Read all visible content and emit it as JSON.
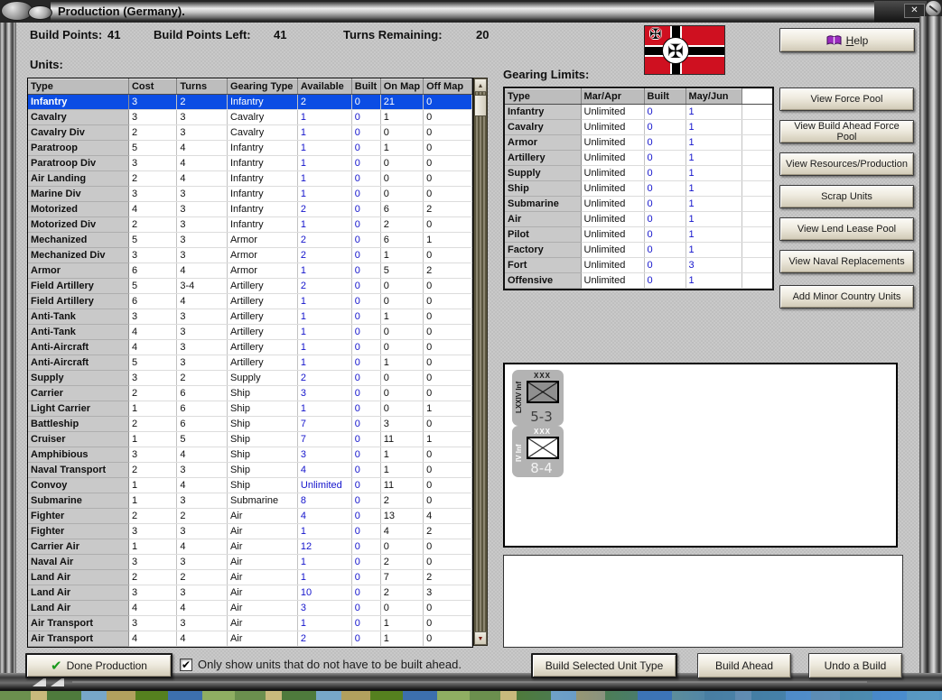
{
  "window": {
    "title": "Production (Germany).",
    "close_glyph": "✕"
  },
  "header": {
    "build_points_label": "Build Points:",
    "build_points_value": "41",
    "build_points_left_label": "Build Points Left:",
    "build_points_left_value": "41",
    "turns_remaining_label": "Turns Remaining:",
    "turns_remaining_value": "20",
    "help_label": "Help"
  },
  "units_section": {
    "label": "Units:",
    "columns": [
      "Type",
      "Cost",
      "Turns",
      "Gearing Type",
      "Available",
      "Built",
      "On Map",
      "Off Map"
    ],
    "rows": [
      {
        "type": "Infantry",
        "cost": "3",
        "turns": "2",
        "gearing": "Infantry",
        "available": "2",
        "built": "0",
        "on_map": "21",
        "off_map": "0",
        "selected": true
      },
      {
        "type": "Cavalry",
        "cost": "3",
        "turns": "3",
        "gearing": "Cavalry",
        "available": "1",
        "built": "0",
        "on_map": "1",
        "off_map": "0"
      },
      {
        "type": "Cavalry Div",
        "cost": "2",
        "turns": "3",
        "gearing": "Cavalry",
        "available": "1",
        "built": "0",
        "on_map": "0",
        "off_map": "0"
      },
      {
        "type": "Paratroop",
        "cost": "5",
        "turns": "4",
        "gearing": "Infantry",
        "available": "1",
        "built": "0",
        "on_map": "1",
        "off_map": "0"
      },
      {
        "type": "Paratroop Div",
        "cost": "3",
        "turns": "4",
        "gearing": "Infantry",
        "available": "1",
        "built": "0",
        "on_map": "0",
        "off_map": "0"
      },
      {
        "type": "Air Landing",
        "cost": "2",
        "turns": "4",
        "gearing": "Infantry",
        "available": "1",
        "built": "0",
        "on_map": "0",
        "off_map": "0"
      },
      {
        "type": "Marine Div",
        "cost": "3",
        "turns": "3",
        "gearing": "Infantry",
        "available": "1",
        "built": "0",
        "on_map": "0",
        "off_map": "0"
      },
      {
        "type": "Motorized",
        "cost": "4",
        "turns": "3",
        "gearing": "Infantry",
        "available": "2",
        "built": "0",
        "on_map": "6",
        "off_map": "2"
      },
      {
        "type": "Motorized Div",
        "cost": "2",
        "turns": "3",
        "gearing": "Infantry",
        "available": "1",
        "built": "0",
        "on_map": "2",
        "off_map": "0"
      },
      {
        "type": "Mechanized",
        "cost": "5",
        "turns": "3",
        "gearing": "Armor",
        "available": "2",
        "built": "0",
        "on_map": "6",
        "off_map": "1"
      },
      {
        "type": "Mechanized Div",
        "cost": "3",
        "turns": "3",
        "gearing": "Armor",
        "available": "2",
        "built": "0",
        "on_map": "1",
        "off_map": "0"
      },
      {
        "type": "Armor",
        "cost": "6",
        "turns": "4",
        "gearing": "Armor",
        "available": "1",
        "built": "0",
        "on_map": "5",
        "off_map": "2"
      },
      {
        "type": "Field Artillery",
        "cost": "5",
        "turns": "3-4",
        "gearing": "Artillery",
        "available": "2",
        "built": "0",
        "on_map": "0",
        "off_map": "0"
      },
      {
        "type": "Field Artillery",
        "cost": "6",
        "turns": "4",
        "gearing": "Artillery",
        "available": "1",
        "built": "0",
        "on_map": "0",
        "off_map": "0"
      },
      {
        "type": "Anti-Tank",
        "cost": "3",
        "turns": "3",
        "gearing": "Artillery",
        "available": "1",
        "built": "0",
        "on_map": "1",
        "off_map": "0"
      },
      {
        "type": "Anti-Tank",
        "cost": "4",
        "turns": "3",
        "gearing": "Artillery",
        "available": "1",
        "built": "0",
        "on_map": "0",
        "off_map": "0"
      },
      {
        "type": "Anti-Aircraft",
        "cost": "4",
        "turns": "3",
        "gearing": "Artillery",
        "available": "1",
        "built": "0",
        "on_map": "0",
        "off_map": "0"
      },
      {
        "type": "Anti-Aircraft",
        "cost": "5",
        "turns": "3",
        "gearing": "Artillery",
        "available": "1",
        "built": "0",
        "on_map": "1",
        "off_map": "0"
      },
      {
        "type": "Supply",
        "cost": "3",
        "turns": "2",
        "gearing": "Supply",
        "available": "2",
        "built": "0",
        "on_map": "0",
        "off_map": "0"
      },
      {
        "type": "Carrier",
        "cost": "2",
        "turns": "6",
        "gearing": "Ship",
        "available": "3",
        "built": "0",
        "on_map": "0",
        "off_map": "0"
      },
      {
        "type": "Light Carrier",
        "cost": "1",
        "turns": "6",
        "gearing": "Ship",
        "available": "1",
        "built": "0",
        "on_map": "0",
        "off_map": "1"
      },
      {
        "type": "Battleship",
        "cost": "2",
        "turns": "6",
        "gearing": "Ship",
        "available": "7",
        "built": "0",
        "on_map": "3",
        "off_map": "0"
      },
      {
        "type": "Cruiser",
        "cost": "1",
        "turns": "5",
        "gearing": "Ship",
        "available": "7",
        "built": "0",
        "on_map": "11",
        "off_map": "1"
      },
      {
        "type": "Amphibious",
        "cost": "3",
        "turns": "4",
        "gearing": "Ship",
        "available": "3",
        "built": "0",
        "on_map": "1",
        "off_map": "0"
      },
      {
        "type": "Naval Transport",
        "cost": "2",
        "turns": "3",
        "gearing": "Ship",
        "available": "4",
        "built": "0",
        "on_map": "1",
        "off_map": "0"
      },
      {
        "type": "Convoy",
        "cost": "1",
        "turns": "4",
        "gearing": "Ship",
        "available": "Unlimited",
        "built": "0",
        "on_map": "11",
        "off_map": "0"
      },
      {
        "type": "Submarine",
        "cost": "1",
        "turns": "3",
        "gearing": "Submarine",
        "available": "8",
        "built": "0",
        "on_map": "2",
        "off_map": "0"
      },
      {
        "type": "Fighter",
        "cost": "2",
        "turns": "2",
        "gearing": "Air",
        "available": "4",
        "built": "0",
        "on_map": "13",
        "off_map": "4"
      },
      {
        "type": "Fighter",
        "cost": "3",
        "turns": "3",
        "gearing": "Air",
        "available": "1",
        "built": "0",
        "on_map": "4",
        "off_map": "2"
      },
      {
        "type": "Carrier Air",
        "cost": "1",
        "turns": "4",
        "gearing": "Air",
        "available": "12",
        "built": "0",
        "on_map": "0",
        "off_map": "0"
      },
      {
        "type": "Naval Air",
        "cost": "3",
        "turns": "3",
        "gearing": "Air",
        "available": "1",
        "built": "0",
        "on_map": "2",
        "off_map": "0"
      },
      {
        "type": "Land Air",
        "cost": "2",
        "turns": "2",
        "gearing": "Air",
        "available": "1",
        "built": "0",
        "on_map": "7",
        "off_map": "2"
      },
      {
        "type": "Land Air",
        "cost": "3",
        "turns": "3",
        "gearing": "Air",
        "available": "10",
        "built": "0",
        "on_map": "2",
        "off_map": "3"
      },
      {
        "type": "Land Air",
        "cost": "4",
        "turns": "4",
        "gearing": "Air",
        "available": "3",
        "built": "0",
        "on_map": "0",
        "off_map": "0"
      },
      {
        "type": "Air Transport",
        "cost": "3",
        "turns": "3",
        "gearing": "Air",
        "available": "1",
        "built": "0",
        "on_map": "1",
        "off_map": "0"
      },
      {
        "type": "Air Transport",
        "cost": "4",
        "turns": "4",
        "gearing": "Air",
        "available": "2",
        "built": "0",
        "on_map": "1",
        "off_map": "0"
      }
    ]
  },
  "gearing_section": {
    "label": "Gearing Limits:",
    "columns": [
      "Type",
      "Mar/Apr",
      "Built",
      "May/Jun"
    ],
    "rows": [
      {
        "type": "Infantry",
        "mar_apr": "Unlimited",
        "built": "0",
        "may_jun": "1"
      },
      {
        "type": "Cavalry",
        "mar_apr": "Unlimited",
        "built": "0",
        "may_jun": "1"
      },
      {
        "type": "Armor",
        "mar_apr": "Unlimited",
        "built": "0",
        "may_jun": "1"
      },
      {
        "type": "Artillery",
        "mar_apr": "Unlimited",
        "built": "0",
        "may_jun": "1"
      },
      {
        "type": "Supply",
        "mar_apr": "Unlimited",
        "built": "0",
        "may_jun": "1"
      },
      {
        "type": "Ship",
        "mar_apr": "Unlimited",
        "built": "0",
        "may_jun": "1"
      },
      {
        "type": "Submarine",
        "mar_apr": "Unlimited",
        "built": "0",
        "may_jun": "1"
      },
      {
        "type": "Air",
        "mar_apr": "Unlimited",
        "built": "0",
        "may_jun": "1"
      },
      {
        "type": "Pilot",
        "mar_apr": "Unlimited",
        "built": "0",
        "may_jun": "1"
      },
      {
        "type": "Factory",
        "mar_apr": "Unlimited",
        "built": "0",
        "may_jun": "1"
      },
      {
        "type": "Fort",
        "mar_apr": "Unlimited",
        "built": "0",
        "may_jun": "3"
      },
      {
        "type": "Offensive",
        "mar_apr": "Unlimited",
        "built": "0",
        "may_jun": "1"
      }
    ]
  },
  "side_buttons": [
    {
      "label": "View Force Pool"
    },
    {
      "label": "View Build Ahead Force Pool"
    },
    {
      "label": "View Resources/Production"
    },
    {
      "label": "Scrap Units"
    },
    {
      "label": "View Lend Lease Pool"
    },
    {
      "label": "View Naval Replacements"
    },
    {
      "label": "Add Minor Country Units"
    }
  ],
  "unit_counters": [
    {
      "size_label": "XXX",
      "name": "LXXIV Inf",
      "strength": "5-3",
      "variant": "dark"
    },
    {
      "size_label": "XXX",
      "name": "IV Inf",
      "strength": "8-4",
      "variant": "light"
    }
  ],
  "flag": {
    "name": "German war ensign",
    "cross_glyph": "✠"
  },
  "footer": {
    "done_button": "Done Production",
    "checkbox_checked": true,
    "checkbox_glyph": "✔",
    "checkbox_label": "Only show units that do not have to be built ahead.",
    "build_selected_button": "Build Selected Unit Type",
    "build_ahead_button": "Build Ahead",
    "undo_button": "Undo a Build"
  },
  "colors": {
    "selected_row": "#0b4de4",
    "value_blue": "#1414cc",
    "flag_red": "#cf1020",
    "check_green": "#18991c"
  }
}
